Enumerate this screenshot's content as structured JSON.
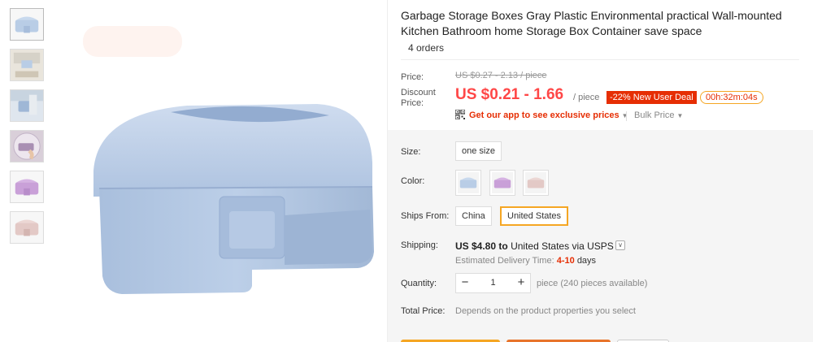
{
  "thumbnails": [
    {
      "name": "thumb-blue-box",
      "color": "#b9cde6"
    },
    {
      "name": "thumb-scene-1",
      "color": "#d6d2c8"
    },
    {
      "name": "thumb-scene-2",
      "color": "#c8d4e0"
    },
    {
      "name": "thumb-purple-hand",
      "color": "#a98fb3"
    },
    {
      "name": "thumb-purple-box",
      "color": "#c9a0d8"
    },
    {
      "name": "thumb-pink-box",
      "color": "#e3c9c6"
    }
  ],
  "product": {
    "title": "Garbage Storage Boxes Gray Plastic Environmental practical Wall-mounted Kitchen Bathroom home Storage Box Container save space",
    "orders": "4 orders"
  },
  "price": {
    "label": "Price:",
    "original": "US $0.27 - 2.13 / piece",
    "discount_label": "Discount Price:",
    "discount": "US $0.21 - 1.66",
    "unit": "/ piece",
    "sale_badge": "-22% New User Deal",
    "timer": "00h:32m:04s",
    "app_promo": "Get our app to see exclusive prices",
    "bulk": "Bulk Price"
  },
  "sku": {
    "size_label": "Size:",
    "size_options": [
      "one size"
    ],
    "color_label": "Color:",
    "color_options": [
      {
        "name": "blue",
        "hex": "#b9cde6"
      },
      {
        "name": "purple",
        "hex": "#c9a0d8"
      },
      {
        "name": "pink",
        "hex": "#e3c9c6"
      }
    ],
    "ships_label": "Ships From:",
    "ships_options": [
      "China",
      "United States"
    ],
    "ships_selected": "United States"
  },
  "shipping": {
    "label": "Shipping:",
    "cost": "US $4.80",
    "to_word": "to",
    "destination": "United States",
    "via": "via USPS",
    "estimate_label": "Estimated Delivery Time:",
    "estimate_days": "4-10",
    "days_word": "days"
  },
  "quantity": {
    "label": "Quantity:",
    "value": "1",
    "available": "piece (240 pieces available)"
  },
  "total": {
    "label": "Total Price:",
    "hint": "Depends on the product properties you select"
  },
  "colors": {
    "accent_red": "#e62e04",
    "price_red": "#ff4747",
    "selected_border": "#f5a623",
    "product_blue": "#b9cde6"
  }
}
